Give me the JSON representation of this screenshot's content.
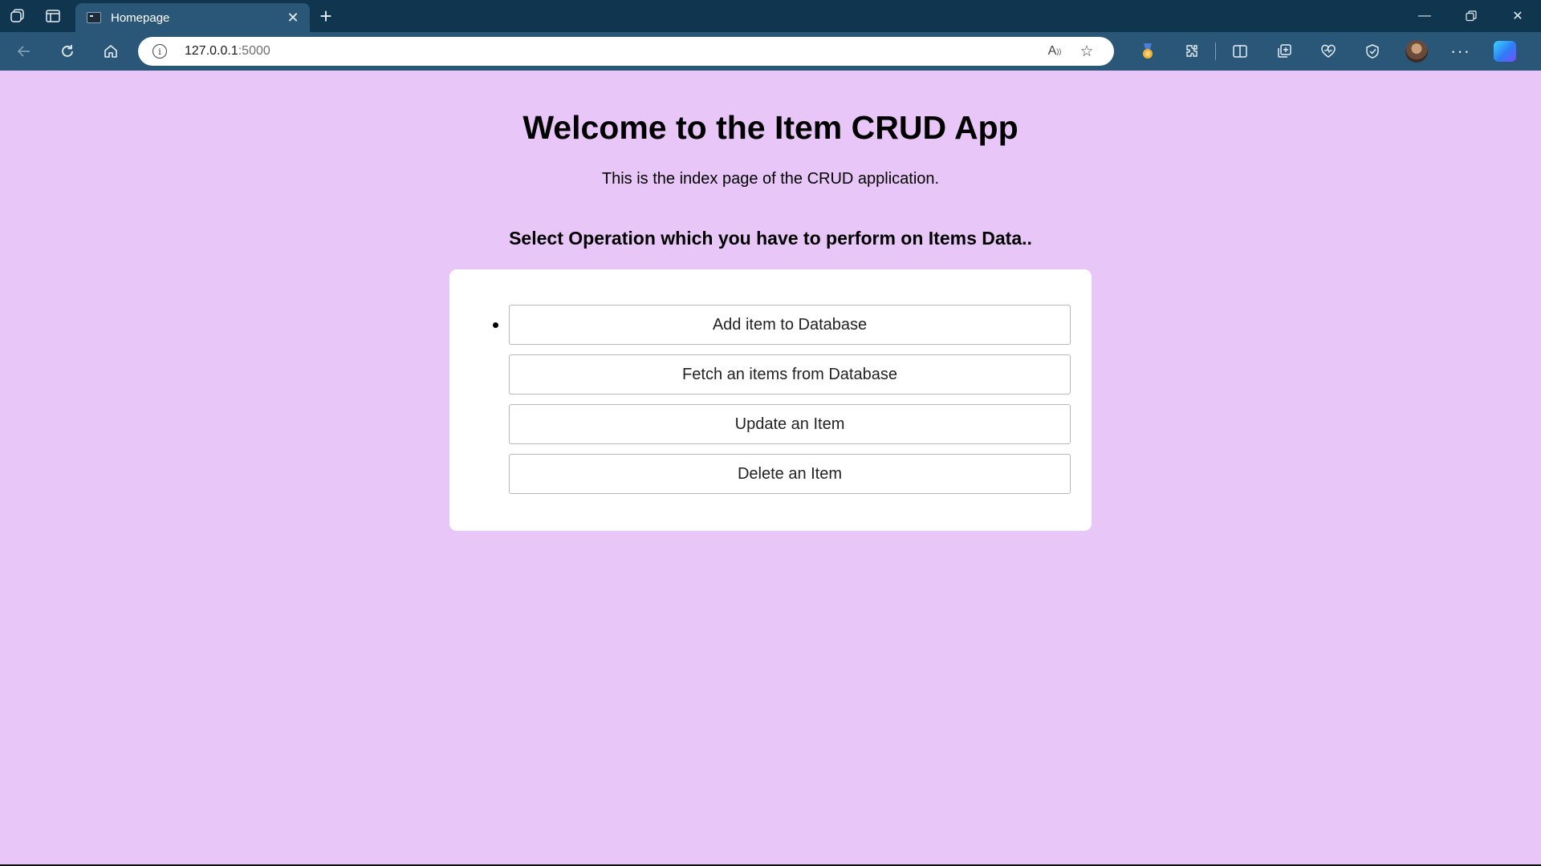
{
  "browser": {
    "tab": {
      "title": "Homepage",
      "close_icon": "close-icon",
      "favicon": "terminal-favicon-icon"
    },
    "window_controls": [
      "minimize-icon",
      "restore-icon",
      "close-icon"
    ],
    "url_host": "127.0.0.1",
    "url_port": ":5000",
    "toolbar_icons": [
      "back-arrow-icon",
      "reload-icon",
      "home-icon",
      "info-icon",
      "read-aloud-icon",
      "favorite-star-icon",
      "rewards-badge-icon",
      "extensions-icon",
      "split-screen-icon",
      "collections-icon",
      "browser-essentials-icon",
      "performance-icon",
      "profile-avatar",
      "more-menu-icon",
      "copilot-icon"
    ],
    "colors": {
      "titlebar": "#10354f",
      "toolbar": "#2a5778",
      "page_bg": "#e8c6f7"
    }
  },
  "page": {
    "title": "Welcome to the Item CRUD App",
    "subtitle": "This is the index page of the CRUD application.",
    "section_heading": "Select Operation which you have to perform on Items Data..",
    "operations": [
      {
        "label": "Add item to Database"
      },
      {
        "label": "Fetch an items from Database"
      },
      {
        "label": "Update an Item"
      },
      {
        "label": "Delete an Item"
      }
    ]
  }
}
